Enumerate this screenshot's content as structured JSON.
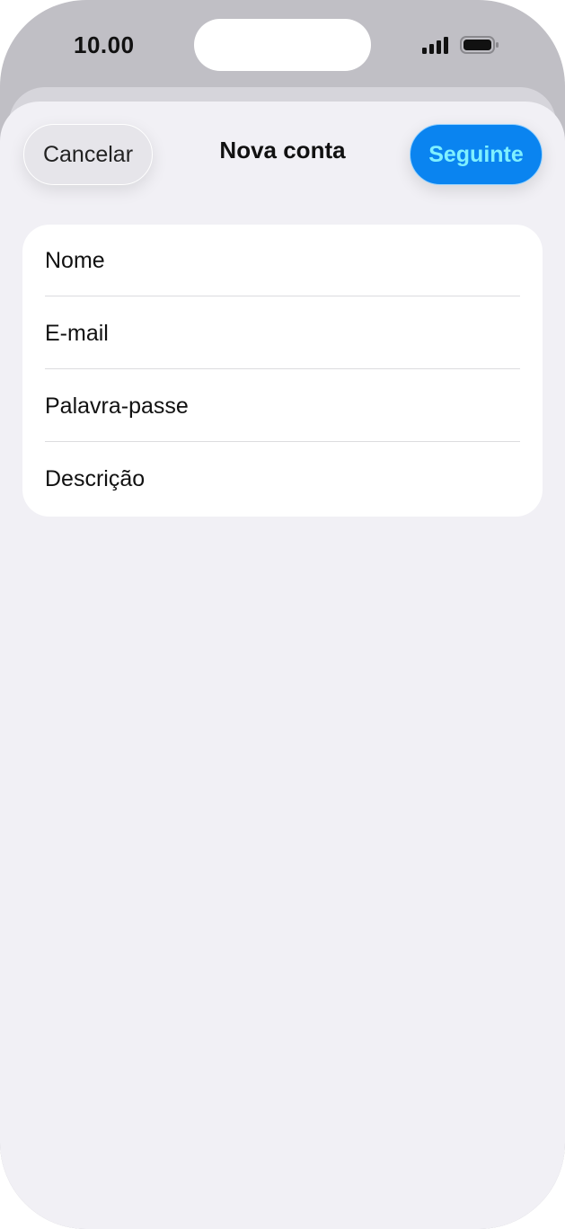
{
  "status_bar": {
    "time": "10.00",
    "signal_icon": "cellular-signal-icon",
    "battery_icon": "battery-icon"
  },
  "nav": {
    "cancel_label": "Cancelar",
    "title": "Nova conta",
    "next_label": "Seguinte"
  },
  "form": {
    "fields": [
      {
        "placeholder": "Nome",
        "value": ""
      },
      {
        "placeholder": "E-mail",
        "value": ""
      },
      {
        "placeholder": "Palavra-passe",
        "value": ""
      },
      {
        "placeholder": "Descrição",
        "value": ""
      }
    ]
  },
  "colors": {
    "accent": "#0a84f0",
    "accent_text": "#7ff0ff",
    "sheet_background": "#f1f0f5",
    "card_background": "#ffffff"
  }
}
